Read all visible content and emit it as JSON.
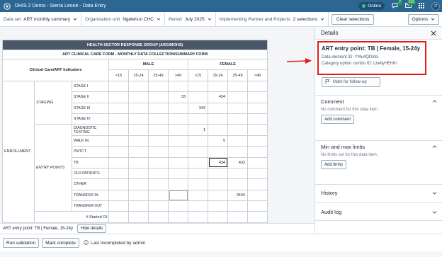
{
  "header": {
    "title": "DHIS 2 Demo - Sierra Leone - Data Entry",
    "online_label": "Online",
    "messages_count": "7",
    "interpretations_count": "235",
    "user_initials": "JT"
  },
  "context": {
    "dataset_label": "Data set",
    "dataset_value": "ART monthly summary",
    "orgunit_label": "Organisation unit",
    "orgunit_value": "Ngelehun CHC",
    "period_label": "Period",
    "period_value": "July 2025",
    "partner_label": "Implementing Partner and Projects",
    "partner_value": "2 selections",
    "clear_label": "Clear selections",
    "options_label": "Options"
  },
  "form": {
    "banner": "HEALTH SECTOR RESPONSE GROUP (ARG/MOHS)",
    "subtitle": "ART CLINICAL CARE FORM - MONTHLY DATA COLLECTION/SUMMARY FORM",
    "indicator_header": "Clinical Care/ART Indicators",
    "male_header": "MALE",
    "female_header": "FEMALE",
    "age_groups": [
      "<15",
      "15-24",
      "25-49",
      ">49"
    ],
    "enrollment_label": "ENROLLMENT",
    "staging_label": "STAGING",
    "entry_points_label": "ENTRY POINTS",
    "started_label": "# Started OI",
    "staging_rows": [
      {
        "label": "STAGE I",
        "values": [
          "",
          "",
          "",
          "",
          "",
          "",
          "",
          ""
        ]
      },
      {
        "label": "STAGE II",
        "values": [
          "",
          "",
          "",
          "33",
          "",
          "434",
          "",
          ""
        ]
      },
      {
        "label": "STAGE III",
        "values": [
          "",
          "",
          "",
          "",
          "343",
          "",
          "",
          ""
        ]
      },
      {
        "label": "STAGE IV",
        "values": [
          "",
          "",
          "",
          "",
          "",
          "",
          "",
          ""
        ]
      }
    ],
    "entry_rows": [
      {
        "label": "DIAGNOSTIC TESTING",
        "values": [
          "",
          "",
          "",
          "",
          "1",
          "",
          "",
          ""
        ]
      },
      {
        "label": "WALK IN",
        "values": [
          "",
          "",
          "",
          "",
          "",
          "5",
          "",
          ""
        ]
      },
      {
        "label": "PMTCT",
        "values": [
          "",
          "",
          "",
          "",
          "",
          "",
          "",
          ""
        ]
      },
      {
        "label": "TB",
        "values": [
          "",
          "",
          "",
          "",
          "",
          "434",
          "433",
          ""
        ]
      },
      {
        "label": "OLD PATIENTS",
        "values": [
          "",
          "",
          "",
          "",
          "",
          "",
          "",
          ""
        ]
      },
      {
        "label": "OTHER",
        "values": [
          "",
          "",
          "",
          "",
          "",
          "",
          "",
          ""
        ]
      },
      {
        "label": "TRANSFER IN",
        "values": [
          "",
          "",
          "",
          "",
          "",
          "",
          "3434",
          ""
        ]
      },
      {
        "label": "TRANSFER OUT",
        "values": [
          "",
          "",
          "",
          "",
          "",
          "",
          "",
          ""
        ]
      }
    ]
  },
  "entry_strip": {
    "text": "ART entry point: TB | Female, 15-24y",
    "hide_label": "Hide details"
  },
  "bottom": {
    "run_validation": "Run validation",
    "mark_complete": "Mark complete",
    "incompleted_text": "Last incompleted by admin"
  },
  "details": {
    "title": "Details",
    "item_title": "ART entry point: TB | Female, 15-24y",
    "data_element_id": "Data element ID: Yf4u4QDldsi",
    "category_combo_id": "Category option combo ID: LbellyHEhKr",
    "follow_up_label": "Mark for follow-up",
    "comment_title": "Comment",
    "comment_text": "No comment for this data item.",
    "add_comment_label": "Add comment",
    "limits_title": "Min and max limits",
    "limits_text": "No limits set for this data item.",
    "add_limits_label": "Add limits",
    "history_title": "History",
    "audit_title": "Audit log"
  },
  "colors": {
    "header_bg": "#2c6693",
    "highlight_red": "#e21b1b",
    "banner_bg": "#4a5768",
    "online_green": "#42c56b"
  }
}
